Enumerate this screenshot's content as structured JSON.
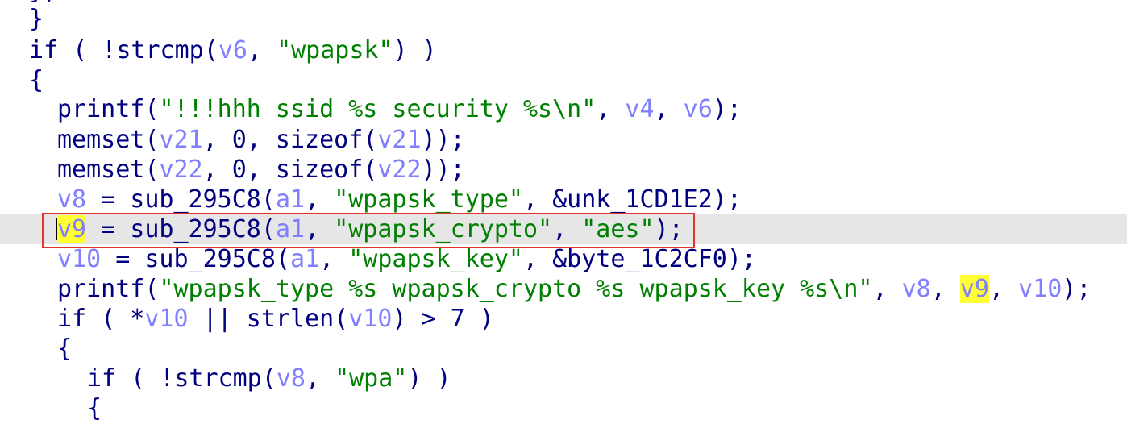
{
  "colors": {
    "background": "#ffffff",
    "code_text": "#000080",
    "variable": "#8080ff",
    "string": "#008000",
    "current_line_background": "#e6e6e6",
    "highlight": "#ffff33",
    "annotation_box": "#e0342c"
  },
  "current_line_index": 8,
  "annotation": {
    "box_around_line": 8
  },
  "lines": [
    {
      "tokens": [
        {
          "t": "}",
          "c": "plain"
        },
        {
          "t": ")",
          "c": "plain"
        }
      ]
    },
    {
      "tokens": [
        {
          "t": "}",
          "c": "plain"
        }
      ]
    },
    {
      "tokens": [
        {
          "t": "if ( !strcmp(",
          "c": "plain"
        },
        {
          "t": "v6",
          "c": "var"
        },
        {
          "t": ", ",
          "c": "plain"
        },
        {
          "t": "\"wpapsk\"",
          "c": "str"
        },
        {
          "t": ") )",
          "c": "plain"
        }
      ]
    },
    {
      "tokens": [
        {
          "t": "{",
          "c": "plain"
        }
      ]
    },
    {
      "tokens": [
        {
          "t": "printf(",
          "c": "plain"
        },
        {
          "t": "\"!!!hhh ssid %s security %s\\n\"",
          "c": "str"
        },
        {
          "t": ", ",
          "c": "plain"
        },
        {
          "t": "v4",
          "c": "var"
        },
        {
          "t": ", ",
          "c": "plain"
        },
        {
          "t": "v6",
          "c": "var"
        },
        {
          "t": ");",
          "c": "plain"
        }
      ]
    },
    {
      "tokens": [
        {
          "t": "memset(",
          "c": "plain"
        },
        {
          "t": "v21",
          "c": "var"
        },
        {
          "t": ", 0, sizeof(",
          "c": "plain"
        },
        {
          "t": "v21",
          "c": "var"
        },
        {
          "t": "));",
          "c": "plain"
        }
      ]
    },
    {
      "tokens": [
        {
          "t": "memset(",
          "c": "plain"
        },
        {
          "t": "v22",
          "c": "var"
        },
        {
          "t": ", 0, sizeof(",
          "c": "plain"
        },
        {
          "t": "v22",
          "c": "var"
        },
        {
          "t": "));",
          "c": "plain"
        }
      ]
    },
    {
      "tokens": [
        {
          "t": "v8",
          "c": "var"
        },
        {
          "t": " = sub_295C8(",
          "c": "plain"
        },
        {
          "t": "a1",
          "c": "var"
        },
        {
          "t": ", ",
          "c": "plain"
        },
        {
          "t": "\"wpapsk_type\"",
          "c": "str"
        },
        {
          "t": ", &unk_1CD1E2);",
          "c": "plain"
        }
      ]
    },
    {
      "tokens": [
        {
          "t": "v9",
          "c": "var",
          "hl": true
        },
        {
          "t": " = sub_295C8(",
          "c": "plain"
        },
        {
          "t": "a1",
          "c": "var"
        },
        {
          "t": ", ",
          "c": "plain"
        },
        {
          "t": "\"wpapsk_crypto\"",
          "c": "str"
        },
        {
          "t": ", ",
          "c": "plain"
        },
        {
          "t": "\"aes\"",
          "c": "str"
        },
        {
          "t": ");",
          "c": "plain"
        }
      ]
    },
    {
      "tokens": [
        {
          "t": "v10",
          "c": "var"
        },
        {
          "t": " = sub_295C8(",
          "c": "plain"
        },
        {
          "t": "a1",
          "c": "var"
        },
        {
          "t": ", ",
          "c": "plain"
        },
        {
          "t": "\"wpapsk_key\"",
          "c": "str"
        },
        {
          "t": ", &byte_1C2CF0);",
          "c": "plain"
        }
      ]
    },
    {
      "tokens": [
        {
          "t": "printf(",
          "c": "plain"
        },
        {
          "t": "\"wpapsk_type %s wpapsk_crypto %s wpapsk_key %s\\n\"",
          "c": "str"
        },
        {
          "t": ", ",
          "c": "plain"
        },
        {
          "t": "v8",
          "c": "var"
        },
        {
          "t": ", ",
          "c": "plain"
        },
        {
          "t": "v9",
          "c": "var",
          "hl": true
        },
        {
          "t": ", ",
          "c": "plain"
        },
        {
          "t": "v10",
          "c": "var"
        },
        {
          "t": ");",
          "c": "plain"
        }
      ]
    },
    {
      "tokens": [
        {
          "t": "if ( *",
          "c": "plain"
        },
        {
          "t": "v10",
          "c": "var"
        },
        {
          "t": " || strlen(",
          "c": "plain"
        },
        {
          "t": "v10",
          "c": "var"
        },
        {
          "t": ") > 7 )",
          "c": "plain"
        }
      ]
    },
    {
      "tokens": [
        {
          "t": "{",
          "c": "plain"
        }
      ]
    },
    {
      "tokens": [
        {
          "t": "if ( !strcmp(",
          "c": "plain"
        },
        {
          "t": "v8",
          "c": "var"
        },
        {
          "t": ", ",
          "c": "plain"
        },
        {
          "t": "\"wpa\"",
          "c": "str"
        },
        {
          "t": ") )",
          "c": "plain"
        }
      ]
    },
    {
      "tokens": [
        {
          "t": "{",
          "c": "plain"
        }
      ]
    }
  ]
}
